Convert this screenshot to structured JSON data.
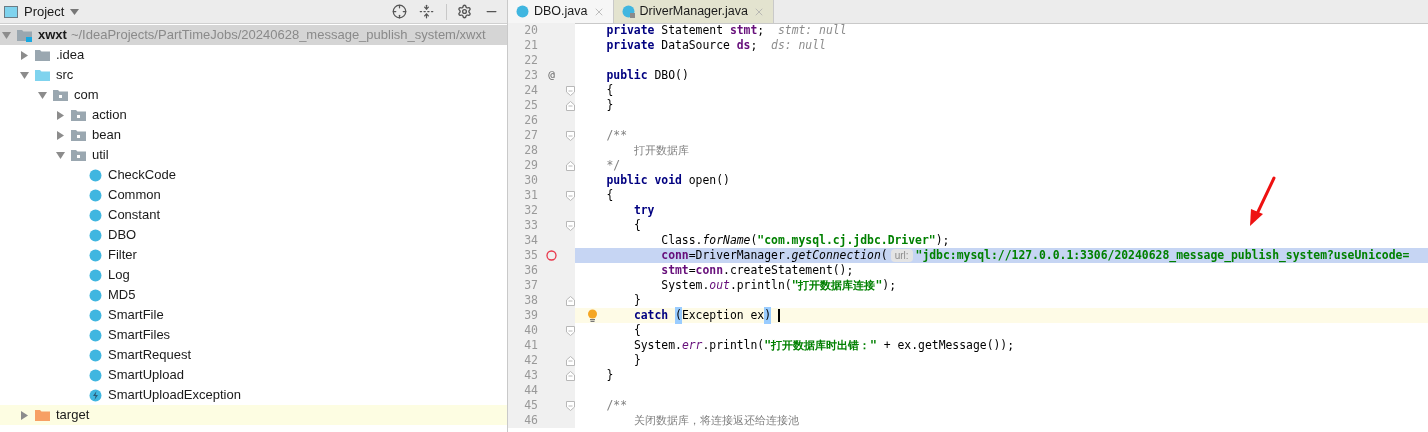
{
  "project_panel": {
    "title": "Project",
    "tree": [
      {
        "name": "xwxt",
        "path": "~/IdeaProjects/PartTimeJobs/20240628_message_publish_system/xwxt",
        "kind": "module",
        "expanded": true,
        "selected": true,
        "children": [
          {
            "name": ".idea",
            "kind": "folder",
            "expanded": false,
            "selected": false
          },
          {
            "name": "src",
            "kind": "source",
            "expanded": true,
            "selected": false,
            "children": [
              {
                "name": "com",
                "kind": "package",
                "expanded": true,
                "selected": false,
                "children": [
                  {
                    "name": "action",
                    "kind": "package",
                    "expanded": false,
                    "selected": false
                  },
                  {
                    "name": "bean",
                    "kind": "package",
                    "expanded": false,
                    "selected": false
                  },
                  {
                    "name": "util",
                    "kind": "package",
                    "expanded": true,
                    "selected": false,
                    "children": [
                      {
                        "name": "CheckCode",
                        "kind": "class",
                        "selected": false
                      },
                      {
                        "name": "Common",
                        "kind": "class",
                        "selected": false
                      },
                      {
                        "name": "Constant",
                        "kind": "class",
                        "selected": false
                      },
                      {
                        "name": "DBO",
                        "kind": "class",
                        "selected": false
                      },
                      {
                        "name": "Filter",
                        "kind": "class",
                        "selected": false
                      },
                      {
                        "name": "Log",
                        "kind": "class",
                        "selected": false
                      },
                      {
                        "name": "MD5",
                        "kind": "class",
                        "selected": false
                      },
                      {
                        "name": "SmartFile",
                        "kind": "class",
                        "selected": false
                      },
                      {
                        "name": "SmartFiles",
                        "kind": "class",
                        "selected": false
                      },
                      {
                        "name": "SmartRequest",
                        "kind": "class",
                        "selected": false
                      },
                      {
                        "name": "SmartUpload",
                        "kind": "class",
                        "selected": false
                      },
                      {
                        "name": "SmartUploadException",
                        "kind": "exception",
                        "selected": false
                      }
                    ]
                  }
                ]
              }
            ]
          },
          {
            "name": "target",
            "kind": "excluded",
            "expanded": false,
            "selected": false
          }
        ]
      }
    ]
  },
  "editor": {
    "tabs": [
      {
        "label": "DBO.java",
        "kind": "class",
        "selected": true
      },
      {
        "label": "DriverManager.java",
        "kind": "library",
        "selected": false
      }
    ],
    "lines": [
      {
        "num": "20",
        "tokens": [
          {
            "t": "    private",
            "kind": "kw"
          },
          {
            "t": " Statement ",
            "kind": "plain"
          },
          {
            "t": "stmt",
            "kind": "field"
          },
          {
            "t": ";",
            "kind": "plain"
          },
          {
            "t": "  stmt: null",
            "kind": "hint"
          }
        ]
      },
      {
        "num": "21",
        "tokens": [
          {
            "t": "    private",
            "kind": "kw"
          },
          {
            "t": " DataSource ",
            "kind": "plain"
          },
          {
            "t": "ds",
            "kind": "field"
          },
          {
            "t": ";",
            "kind": "plain"
          },
          {
            "t": "  ds: null",
            "kind": "hint"
          }
        ]
      },
      {
        "num": "22"
      },
      {
        "num": "23",
        "mark": "@",
        "tokens": [
          {
            "t": "    public",
            "kind": "kw"
          },
          {
            "t": " DBO()",
            "kind": "plain"
          }
        ]
      },
      {
        "num": "24",
        "fold_open": true,
        "tokens": [
          {
            "t": "    {",
            "kind": "plain"
          }
        ]
      },
      {
        "num": "25",
        "fold_close": true,
        "tokens": [
          {
            "t": "    }",
            "kind": "plain"
          }
        ]
      },
      {
        "num": "26"
      },
      {
        "num": "27",
        "fold_open": true,
        "tokens": [
          {
            "t": "    /**",
            "kind": "comment"
          }
        ]
      },
      {
        "num": "28",
        "tokens": [
          {
            "t": "        打开数据库",
            "kind": "comment"
          }
        ]
      },
      {
        "num": "29",
        "fold_close": true,
        "tokens": [
          {
            "t": "    */",
            "kind": "comment"
          }
        ]
      },
      {
        "num": "30",
        "tokens": [
          {
            "t": "    public void",
            "kind": "kw"
          },
          {
            "t": " open()",
            "kind": "plain"
          }
        ]
      },
      {
        "num": "31",
        "fold_open": true,
        "tokens": [
          {
            "t": "    {",
            "kind": "plain"
          }
        ]
      },
      {
        "num": "32",
        "tokens": [
          {
            "t": "        try",
            "kind": "kw"
          }
        ]
      },
      {
        "num": "33",
        "fold_open": true,
        "tokens": [
          {
            "t": "        {",
            "kind": "plain"
          }
        ]
      },
      {
        "num": "34",
        "tokens": [
          {
            "t": "            Class.",
            "kind": "plain"
          },
          {
            "t": "forName",
            "kind": "method"
          },
          {
            "t": "(",
            "kind": "plain"
          },
          {
            "t": "\"com.mysql.cj.jdbc.Driver\"",
            "kind": "str"
          },
          {
            "t": ");",
            "kind": "plain"
          }
        ]
      },
      {
        "num": "35",
        "breakpoint": true,
        "tokens": [
          {
            "t": "            conn",
            "kind": "field"
          },
          {
            "t": "=DriverManager.",
            "kind": "plain"
          },
          {
            "t": "getConnection",
            "kind": "method"
          },
          {
            "t": "(",
            "kind": "plain"
          },
          {
            "t": "url:",
            "kind": "param"
          },
          {
            "t": "\"jdbc:mysql://127.0.0.1:3306/20240628_message_publish_system?useUnicode=",
            "kind": "str"
          }
        ]
      },
      {
        "num": "36",
        "tokens": [
          {
            "t": "            stmt",
            "kind": "field"
          },
          {
            "t": "=",
            "kind": "plain"
          },
          {
            "t": "conn",
            "kind": "field"
          },
          {
            "t": ".createStatement();",
            "kind": "plain"
          }
        ]
      },
      {
        "num": "37",
        "tokens": [
          {
            "t": "            System.",
            "kind": "plain"
          },
          {
            "t": "out",
            "kind": "static"
          },
          {
            "t": ".println(",
            "kind": "plain"
          },
          {
            "t": "\"打开数据库连接\"",
            "kind": "str"
          },
          {
            "t": ");",
            "kind": "plain"
          }
        ]
      },
      {
        "num": "38",
        "fold_close": true,
        "tokens": [
          {
            "t": "        }",
            "kind": "plain"
          }
        ]
      },
      {
        "num": "39",
        "bulb": true,
        "current": true,
        "caret": true,
        "tokens": [
          {
            "t": "        catch ",
            "kind": "kw"
          },
          {
            "t": "(",
            "kind": "match"
          },
          {
            "t": "Exception ex",
            "kind": "plain"
          },
          {
            "t": ")",
            "kind": "match"
          }
        ]
      },
      {
        "num": "40",
        "fold_open": true,
        "tokens": [
          {
            "t": "        {",
            "kind": "plain"
          }
        ]
      },
      {
        "num": "41",
        "tokens": [
          {
            "t": "        System.",
            "kind": "plain"
          },
          {
            "t": "err",
            "kind": "static"
          },
          {
            "t": ".println(",
            "kind": "plain"
          },
          {
            "t": "\"打开数据库时出错：\"",
            "kind": "str"
          },
          {
            "t": " + ex.getMessage());",
            "kind": "plain"
          }
        ]
      },
      {
        "num": "42",
        "fold_close": true,
        "tokens": [
          {
            "t": "        }",
            "kind": "plain"
          }
        ]
      },
      {
        "num": "43",
        "fold_close": true,
        "tokens": [
          {
            "t": "    }",
            "kind": "plain"
          }
        ]
      },
      {
        "num": "44"
      },
      {
        "num": "45",
        "fold_open": true,
        "tokens": [
          {
            "t": "    /**",
            "kind": "comment"
          }
        ]
      },
      {
        "num": "46",
        "tokens": [
          {
            "t": "        关闭数据库，将连接返还给连接池",
            "kind": "comment"
          }
        ]
      }
    ]
  }
}
